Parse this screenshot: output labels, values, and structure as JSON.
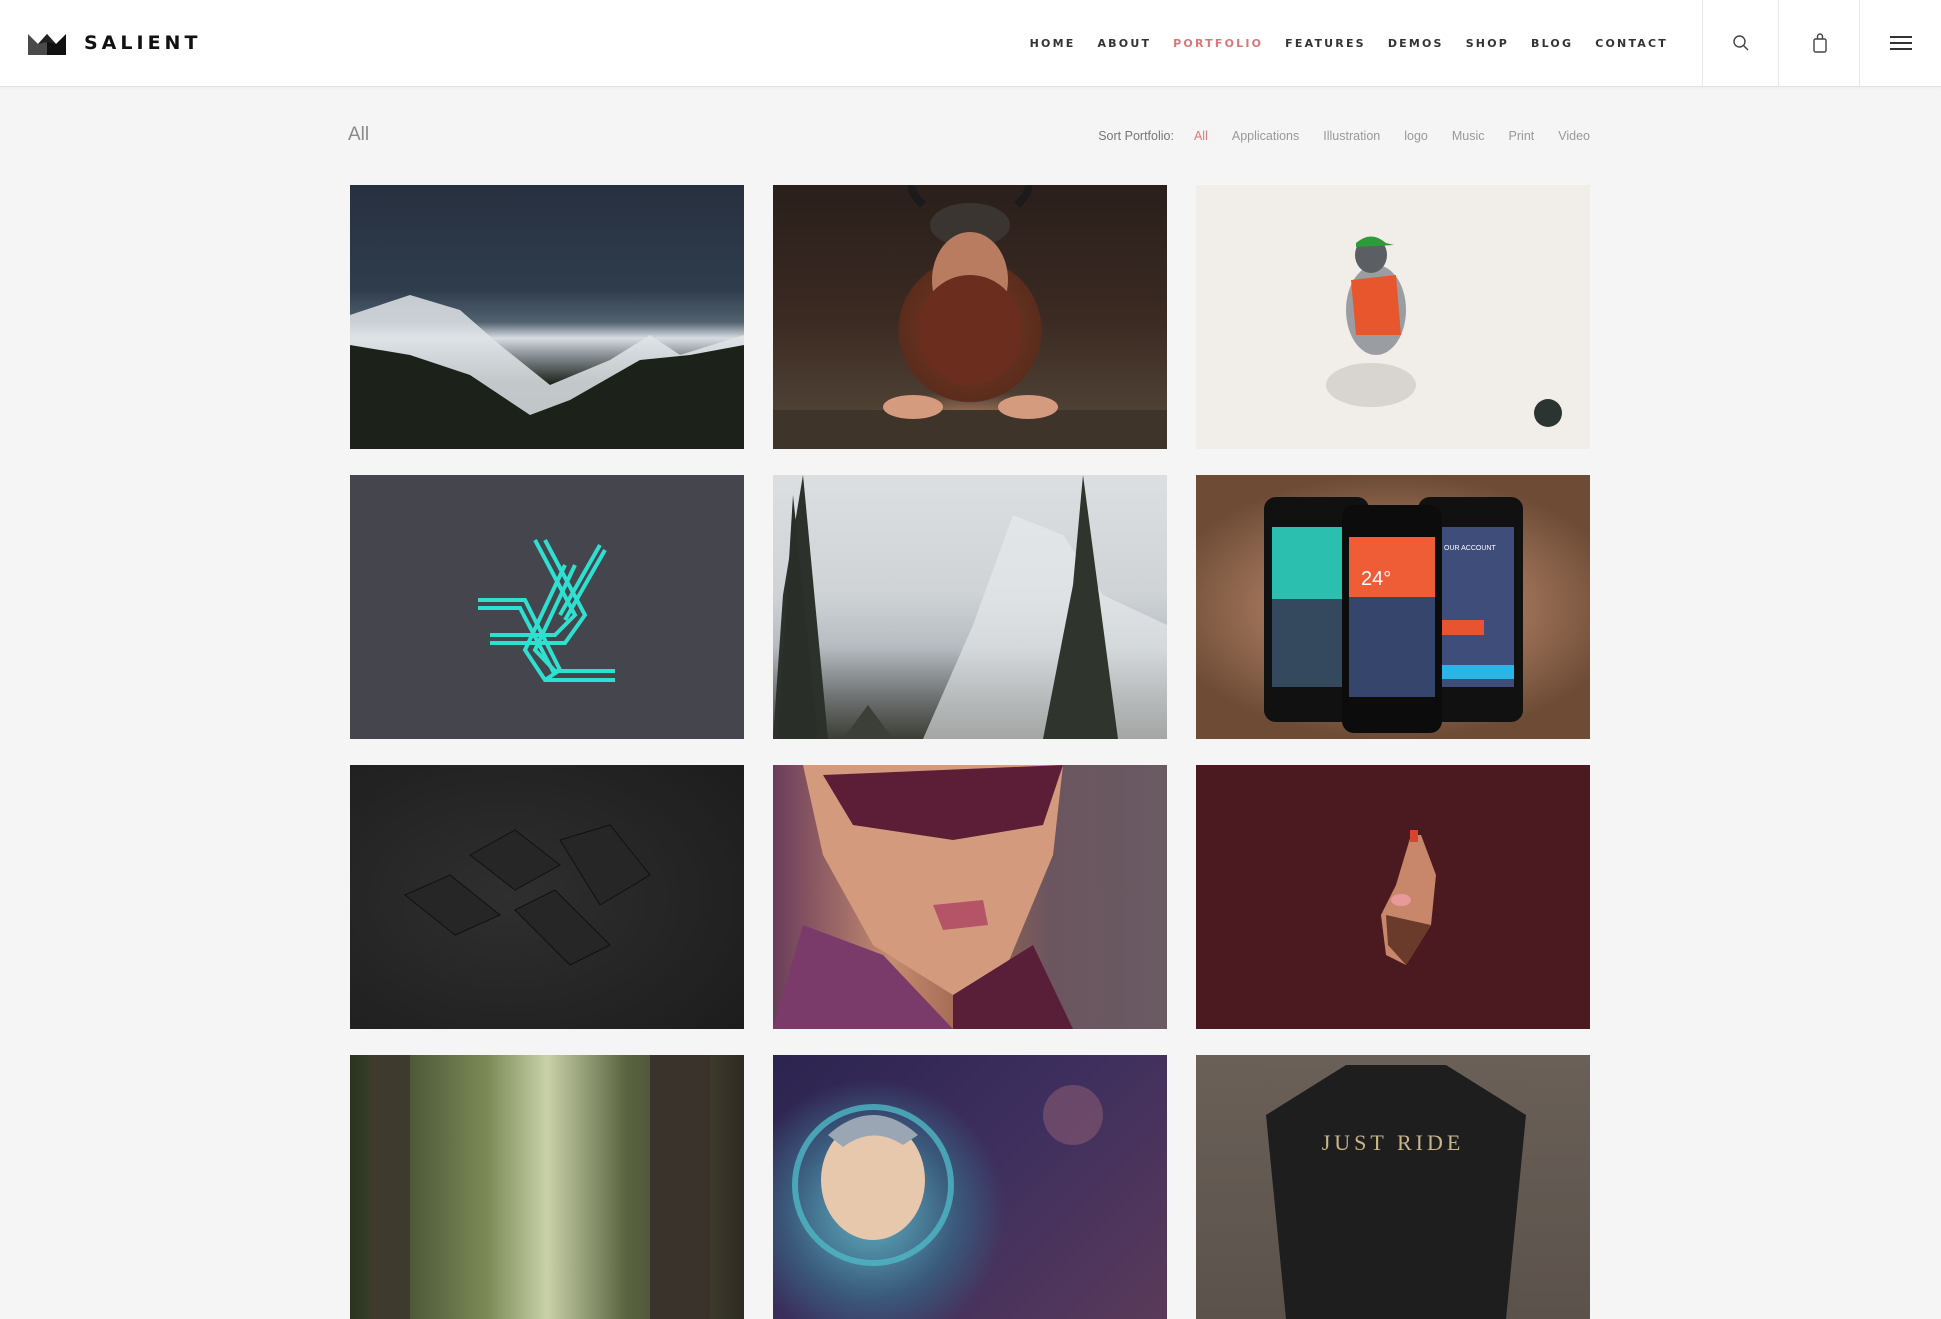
{
  "brand": {
    "name": "SALIENT",
    "logo_icon": "crown-icon"
  },
  "nav": {
    "items": [
      {
        "label": "HOME",
        "active": false
      },
      {
        "label": "ABOUT",
        "active": false
      },
      {
        "label": "PORTFOLIO",
        "active": true
      },
      {
        "label": "FEATURES",
        "active": false
      },
      {
        "label": "DEMOS",
        "active": false
      },
      {
        "label": "SHOP",
        "active": false
      },
      {
        "label": "BLOG",
        "active": false
      },
      {
        "label": "CONTACT",
        "active": false
      }
    ],
    "icons": [
      "search-icon",
      "shopping-bag-icon",
      "hamburger-menu-icon"
    ]
  },
  "colors": {
    "accent": "#d8777a",
    "page_bg": "#f5f5f5",
    "header_bg": "#ffffff"
  },
  "portfolio": {
    "current_filter": "All",
    "sort_label": "Sort Portfolio:",
    "filters": [
      {
        "label": "All",
        "active": true
      },
      {
        "label": "Applications",
        "active": false
      },
      {
        "label": "Illustration",
        "active": false
      },
      {
        "label": "logo",
        "active": false
      },
      {
        "label": "Music",
        "active": false
      },
      {
        "label": "Print",
        "active": false
      },
      {
        "label": "Video",
        "active": false
      }
    ],
    "items": [
      {
        "subject": "snowy mountains at night"
      },
      {
        "subject": "viking character at tavern table"
      },
      {
        "subject": "pigeon in green cap and orange hoodie"
      },
      {
        "subject": "teal geometric logo mark"
      },
      {
        "subject": "pine trees and foggy snowy mountain"
      },
      {
        "subject": "weather app on three phones",
        "phone_text": {
          "temp": "24°",
          "account": "OUR ACCOUNT"
        }
      },
      {
        "subject": "black stationery mockup"
      },
      {
        "subject": "low-poly portrait with sunglasses"
      },
      {
        "subject": "bearded face illustration on maroon"
      },
      {
        "subject": "forest path"
      },
      {
        "subject": "astronaut character in helmet"
      },
      {
        "subject": "black t-shirt",
        "shirt_text": "JUST RIDE"
      }
    ]
  }
}
